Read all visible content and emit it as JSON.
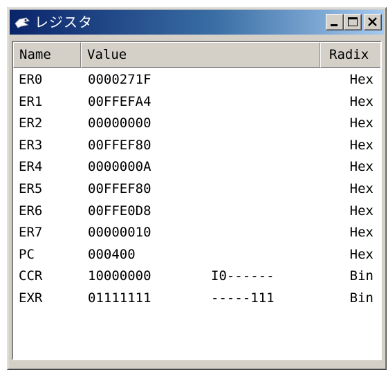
{
  "window": {
    "title": "レジスタ",
    "minimize_label": "_",
    "maximize_label": "□",
    "close_label": "×"
  },
  "table": {
    "columns": [
      "Name",
      "Value",
      "Radix"
    ],
    "rows": [
      {
        "name": "ER0",
        "value": "0000271F",
        "flags": "",
        "radix": "Hex"
      },
      {
        "name": "ER1",
        "value": "00FFEFA4",
        "flags": "",
        "radix": "Hex"
      },
      {
        "name": "ER2",
        "value": "00000000",
        "flags": "",
        "radix": "Hex"
      },
      {
        "name": "ER3",
        "value": "00FFEF80",
        "flags": "",
        "radix": "Hex"
      },
      {
        "name": "ER4",
        "value": "0000000A",
        "flags": "",
        "radix": "Hex"
      },
      {
        "name": "ER5",
        "value": "00FFEF80",
        "flags": "",
        "radix": "Hex"
      },
      {
        "name": "ER6",
        "value": "00FFE0D8",
        "flags": "",
        "radix": "Hex"
      },
      {
        "name": "ER7",
        "value": "00000010",
        "flags": "",
        "radix": "Hex"
      },
      {
        "name": "PC",
        "value": "000400",
        "flags": "",
        "radix": "Hex"
      },
      {
        "name": "CCR",
        "value": "10000000",
        "flags": "I0------",
        "radix": "Bin"
      },
      {
        "name": "EXR",
        "value": "01111111",
        "flags": "-----111",
        "radix": "Bin"
      }
    ]
  },
  "colors": {
    "title_bar_start": "#0a246a",
    "title_bar_end": "#a6caf0",
    "face": "#d4d0c8"
  },
  "icons": {
    "app": "app-icon",
    "minimize": "minimize-icon",
    "maximize": "maximize-icon",
    "close": "close-icon"
  }
}
